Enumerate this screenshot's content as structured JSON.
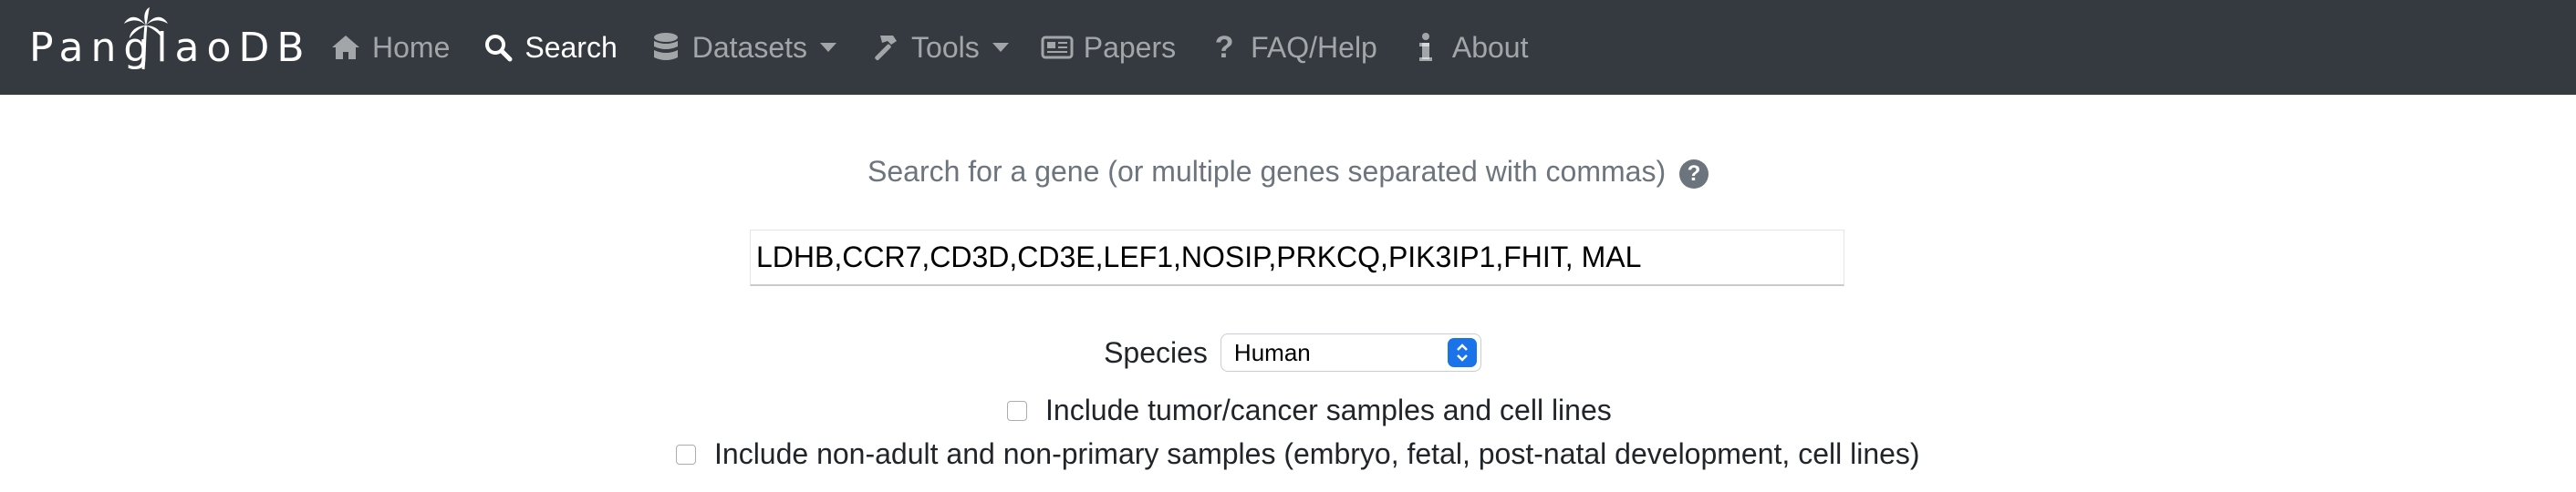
{
  "brand": {
    "name": "PanglaoDB"
  },
  "nav": {
    "items": [
      {
        "label": "Home",
        "icon": "home-icon"
      },
      {
        "label": "Search",
        "icon": "search-icon"
      },
      {
        "label": "Datasets",
        "icon": "database-icon"
      },
      {
        "label": "Tools",
        "icon": "hammer-icon"
      },
      {
        "label": "Papers",
        "icon": "newspaper-icon"
      },
      {
        "label": "FAQ/Help",
        "icon": "question-icon"
      },
      {
        "label": "About",
        "icon": "info-icon"
      }
    ],
    "active": "Search"
  },
  "search": {
    "prompt": "Search for a gene (or multiple genes separated with commas)",
    "help_glyph": "?",
    "value": "LDHB,CCR7,CD3D,CD3E,LEF1,NOSIP,PRKCQ,PIK3IP1,FHIT, MAL"
  },
  "species": {
    "label": "Species",
    "selected": "Human"
  },
  "options": {
    "tumor_label": "Include tumor/cancer samples and cell lines",
    "nonadult_label": "Include non-adult and non-primary samples (embryo, fetal, post-natal development, cell lines)"
  },
  "colors": {
    "navbar": "#343a40",
    "select_accent": "#1a73e8",
    "muted": "#6c757d"
  }
}
